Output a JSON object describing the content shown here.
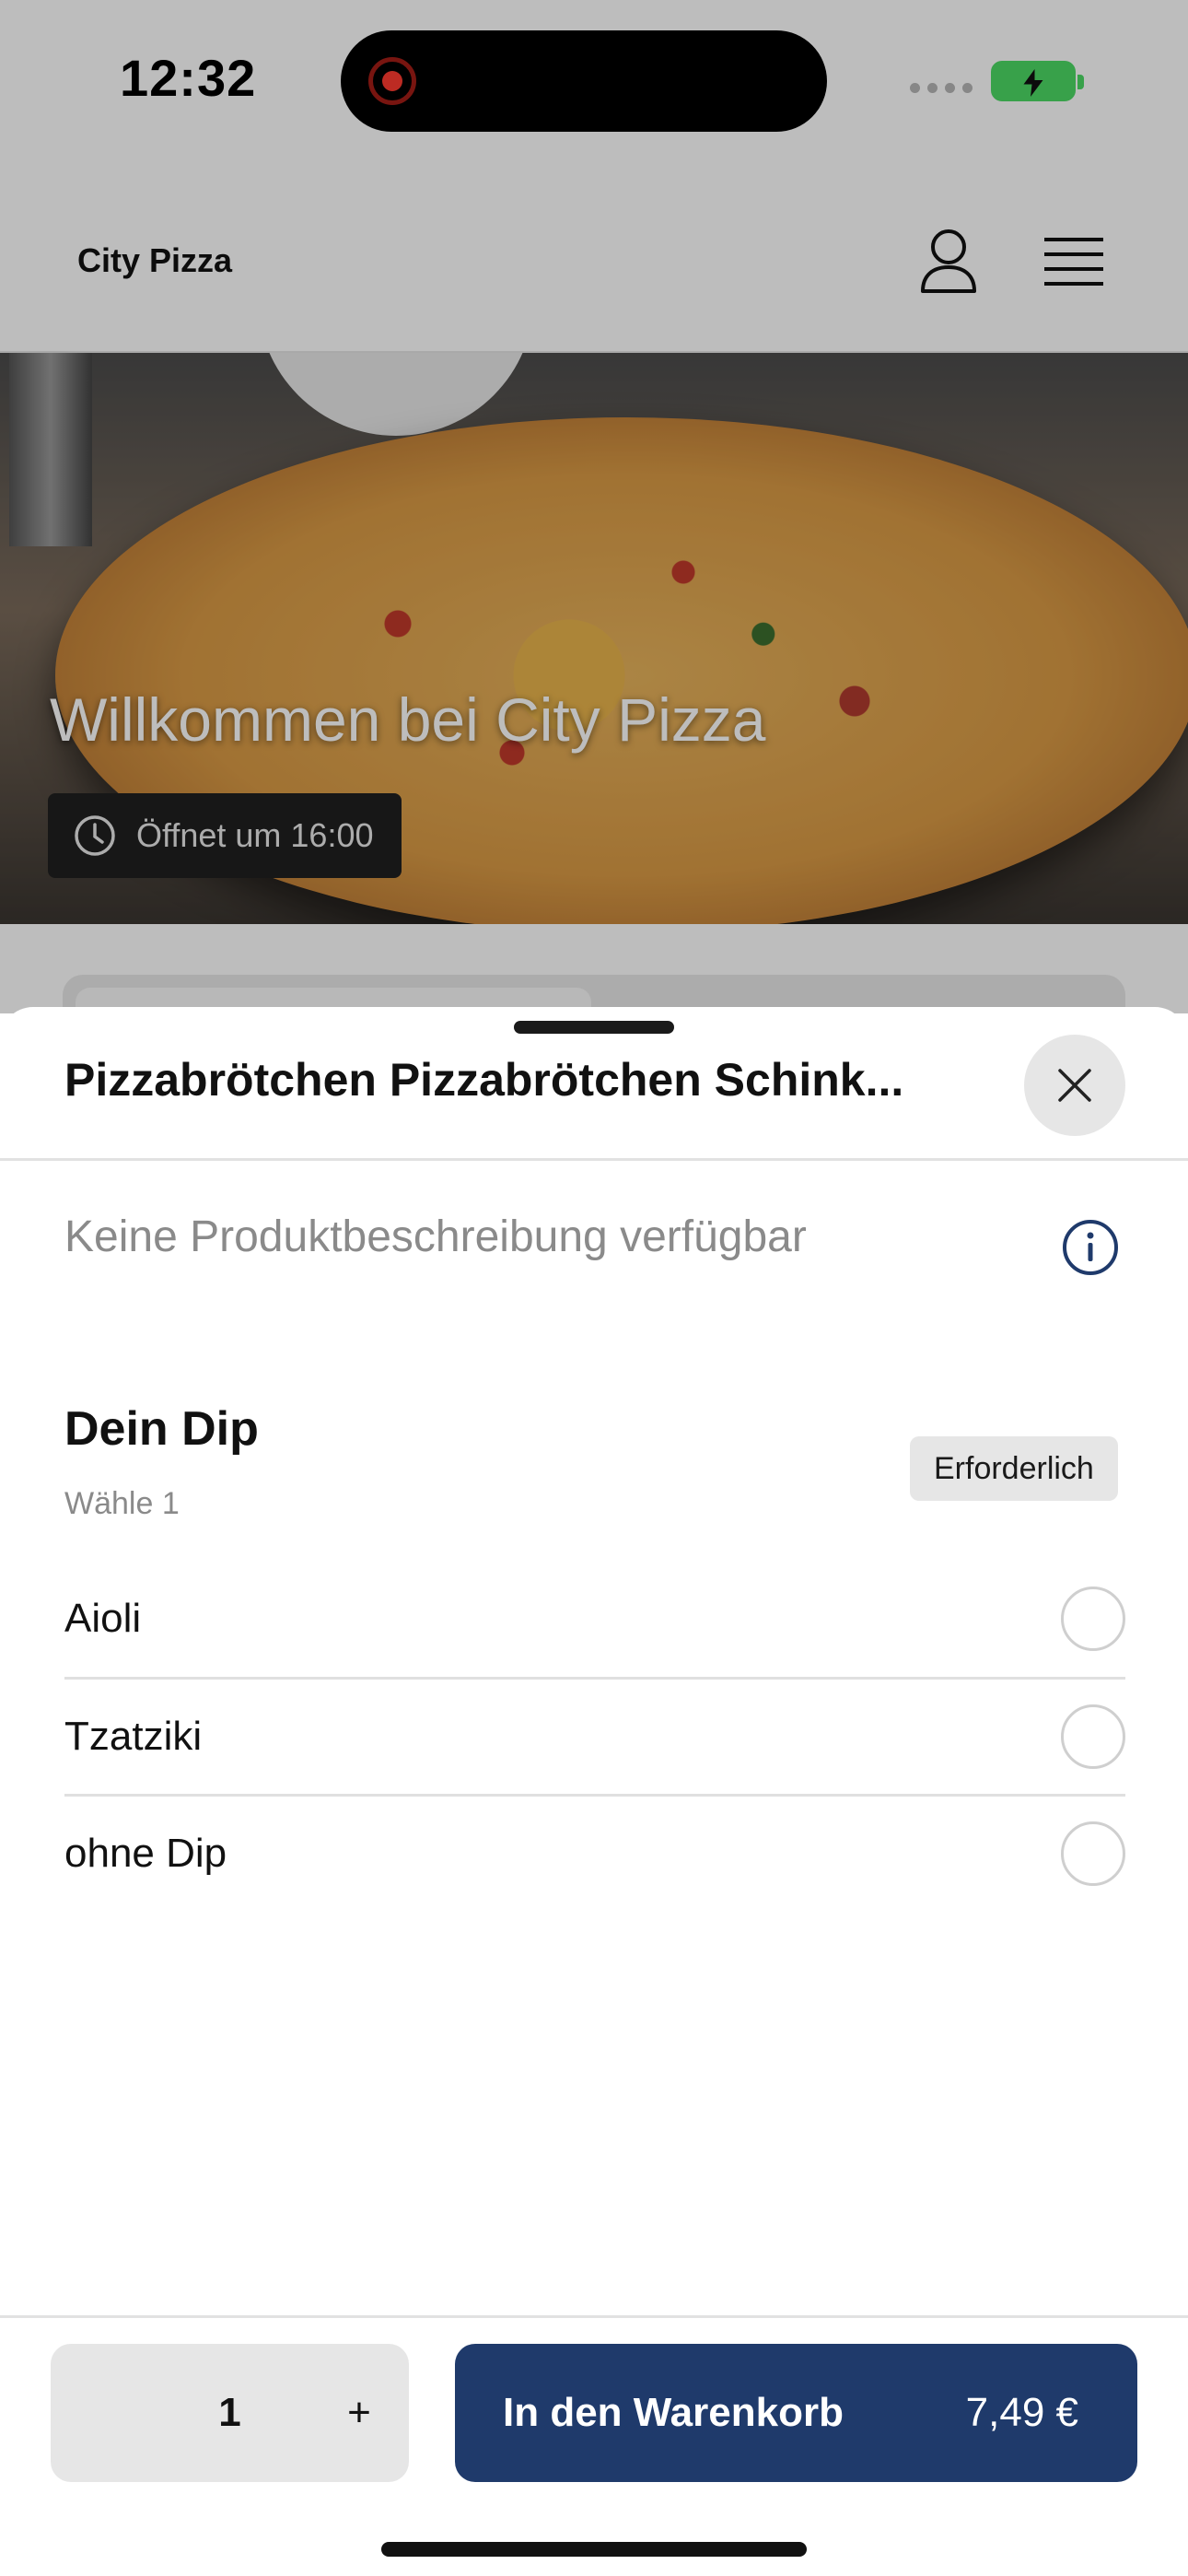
{
  "status_bar": {
    "time": "12:32"
  },
  "header": {
    "brand": "City Pizza"
  },
  "hero": {
    "title": "Willkommen bei City Pizza",
    "hours": "Öffnet um 16:00"
  },
  "sheet": {
    "title": "Pizzabrötchen Pizzabrötchen Schink...",
    "description": "Keine Produktbeschreibung verfügbar",
    "group": {
      "title": "Dein Dip",
      "subtitle": "Wähle 1",
      "badge": "Erforderlich",
      "options": [
        {
          "label": "Aioli"
        },
        {
          "label": "Tzatziki"
        },
        {
          "label": "ohne Dip"
        }
      ]
    }
  },
  "footer": {
    "quantity": "1",
    "plus": "+",
    "cart_label": "In den Warenkorb",
    "price": "7,49 €"
  },
  "colors": {
    "primary_button": "#1f3a6b",
    "info_icon": "#1f3a6b",
    "battery": "#4cd964",
    "recording": "#ff3b30"
  },
  "icons": [
    "user-icon",
    "menu-icon",
    "clock-icon",
    "close-icon",
    "info-icon",
    "battery-icon",
    "charging-bolt-icon"
  ]
}
